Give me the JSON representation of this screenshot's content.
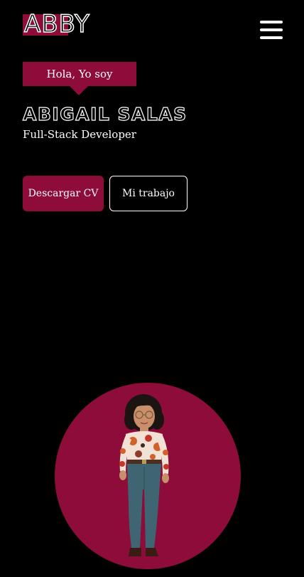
{
  "header": {
    "logo_text": "ABBY"
  },
  "hero": {
    "greeting": "Hola, Yo soy",
    "name": "ABIGAIL SALAS",
    "role": "Full-Stack Developer"
  },
  "actions": {
    "download_cv": "Descargar CV",
    "my_work": "Mi trabajo"
  },
  "colors": {
    "accent": "#8e0c3a",
    "background": "#000000",
    "text": "#ffffff"
  },
  "icons": {
    "menu": "hamburger-menu-icon"
  }
}
